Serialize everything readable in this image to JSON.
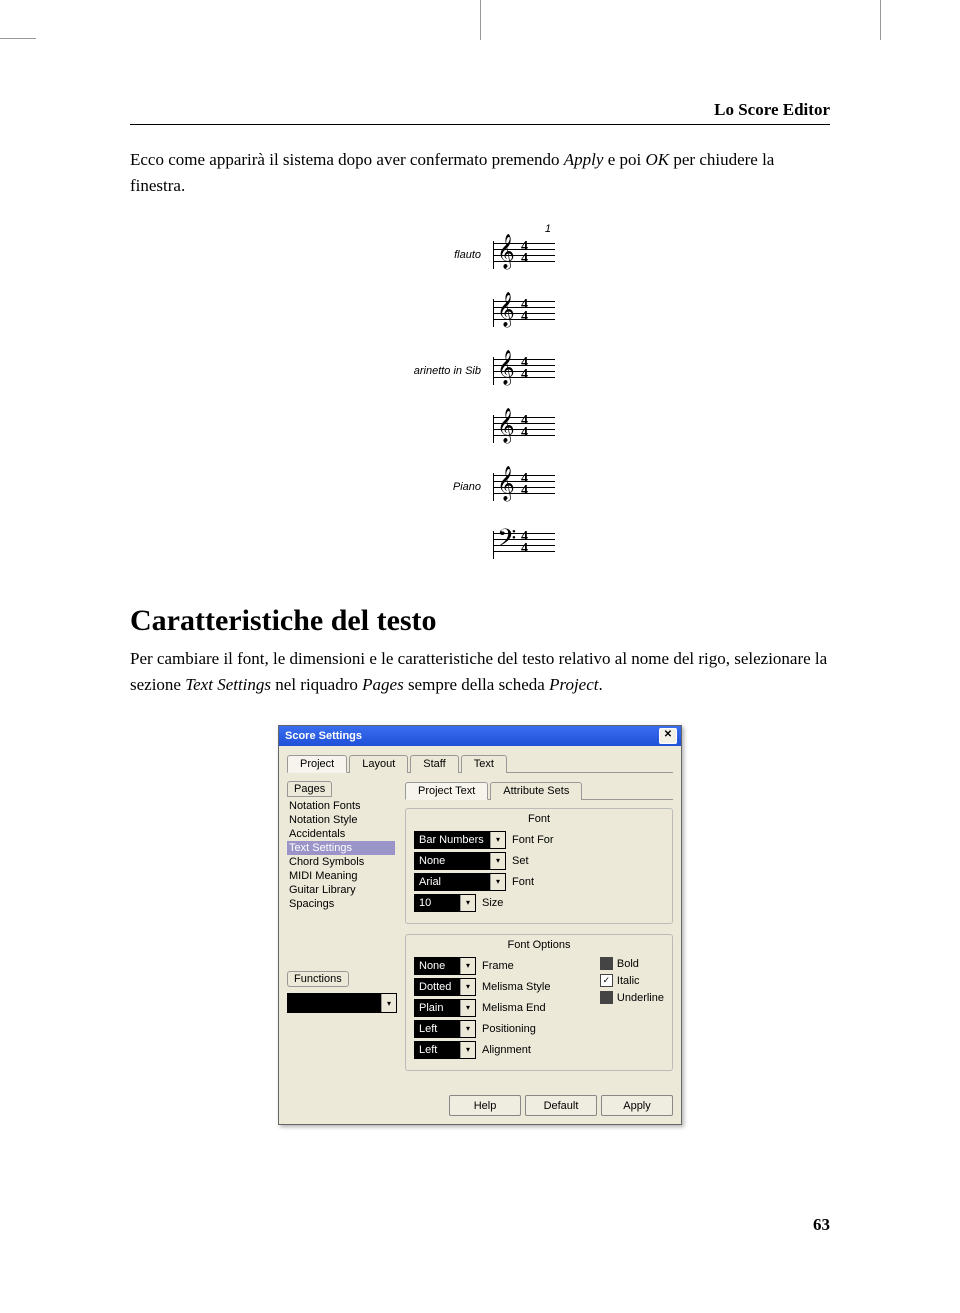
{
  "header": {
    "title": "Lo Score Editor"
  },
  "intro": {
    "prefix": "Ecco come apparirà il sistema dopo aver confermato premendo ",
    "apply": "Apply",
    "mid": " e poi ",
    "ok": "OK",
    "suffix": " per chiudere la finestra."
  },
  "score": {
    "measure_num": "1",
    "time_top": "4",
    "time_bot": "4",
    "labels": [
      "flauto",
      "",
      "arinetto in Sib",
      "",
      "Piano",
      ""
    ],
    "clefs": [
      "𝄞",
      "𝄞",
      "𝄞",
      "𝄞",
      "𝄞",
      "𝄢"
    ]
  },
  "section": {
    "title": "Caratteristiche del testo",
    "body_a": "Per cambiare il font, le dimensioni e le caratteristiche del testo relativo al nome del rigo, selezionare la sezione ",
    "i1": "Text Settings",
    "body_b": " nel riquadro ",
    "i2": "Pages",
    "body_c": " sempre della scheda ",
    "i3": "Project",
    "body_d": "."
  },
  "dialog": {
    "title": "Score Settings",
    "tabs": [
      "Project",
      "Layout",
      "Staff",
      "Text"
    ],
    "active_tab": 0,
    "sub_tabs": [
      "Project Text",
      "Attribute Sets"
    ],
    "active_sub": 0,
    "pages_label": "Pages",
    "pages_items": [
      "Notation Fonts",
      "Notation Style",
      "Accidentals",
      "Text Settings",
      "Chord Symbols",
      "MIDI Meaning",
      "Guitar Library",
      "Spacings"
    ],
    "pages_selected": 3,
    "functions_label": "Functions",
    "font_group": {
      "title": "Font",
      "rows": [
        {
          "combo": "Bar Numbers",
          "label": "Font For"
        },
        {
          "combo": "None",
          "label": "Set"
        },
        {
          "combo": "Arial",
          "label": "Font"
        },
        {
          "combo": "10",
          "label": "Size",
          "narrow": true
        }
      ]
    },
    "options_group": {
      "title": "Font Options",
      "rows": [
        {
          "combo": "None",
          "label": "Frame"
        },
        {
          "combo": "Dotted",
          "label": "Melisma Style"
        },
        {
          "combo": "Plain",
          "label": "Melisma End"
        },
        {
          "combo": "Left",
          "label": "Positioning"
        },
        {
          "combo": "Left",
          "label": "Alignment"
        }
      ],
      "checks": [
        {
          "label": "Bold",
          "checked": false
        },
        {
          "label": "Italic",
          "checked": true
        },
        {
          "label": "Underline",
          "checked": false
        }
      ]
    },
    "buttons": [
      "Help",
      "Default",
      "Apply"
    ]
  },
  "page_number": "63"
}
